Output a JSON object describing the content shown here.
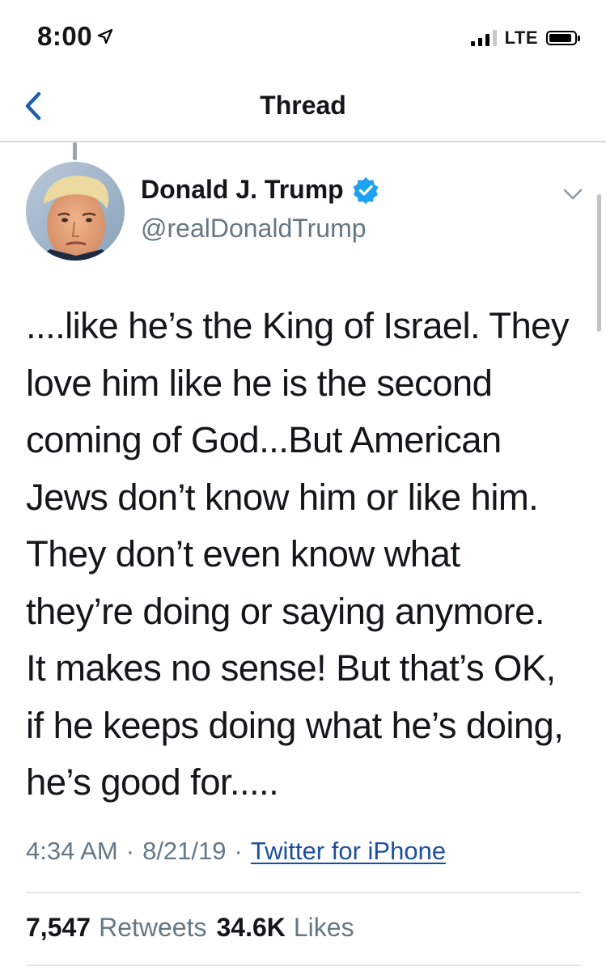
{
  "status_bar": {
    "time": "8:00",
    "carrier": "LTE",
    "signal_bars_active": 3,
    "battery_level": 0.9
  },
  "nav": {
    "title": "Thread",
    "back_icon": "chevron-left-icon"
  },
  "tweet": {
    "author_name": "Donald J. Trump",
    "author_handle": "@realDonaldTrump",
    "verified": true,
    "text_lines": [
      "....like he’s the King of Israel. They",
      "love him like he is the second",
      "coming of God...But American",
      "Jews don’t know him or like him.",
      "They don’t even know what",
      "they’re doing or saying anymore.",
      "It makes no sense! But that’s OK,",
      "if he keeps doing what he’s doing,",
      "he’s good for....."
    ],
    "time": "4:34 AM",
    "date": "8/21/19",
    "separator": "·",
    "source": "Twitter for iPhone",
    "retweets_count": "7,547",
    "retweets_label": "Retweets",
    "likes_count": "34.6K",
    "likes_label": "Likes"
  },
  "colors": {
    "text": "#14171a",
    "secondary": "#657786",
    "link": "#1b4f9c",
    "verified_badge": "#1da1f2",
    "nav_accent": "#1d5fa8"
  }
}
